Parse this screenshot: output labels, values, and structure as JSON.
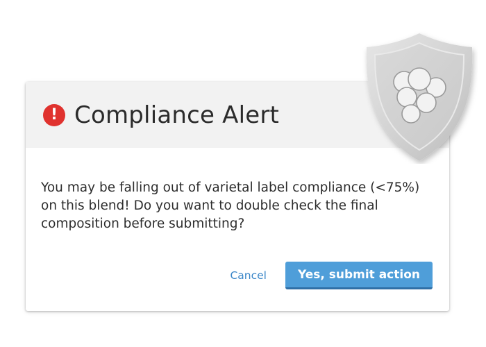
{
  "dialog": {
    "title": "Compliance Alert",
    "alert_icon_glyph": "!",
    "alert_icon": "exclamation-circle-icon",
    "message": "You may be falling out of varietal label compliance (<75%) on this blend! Do you want to double check the final composition before submitting?",
    "cancel_label": "Cancel",
    "submit_label": "Yes, submit action"
  },
  "decoration": {
    "shield_icon": "grape-shield-icon"
  },
  "colors": {
    "alert_red": "#e0322e",
    "primary_blue": "#4f9ed9",
    "link_blue": "#3a86c8",
    "header_bg": "#f2f2f2"
  }
}
